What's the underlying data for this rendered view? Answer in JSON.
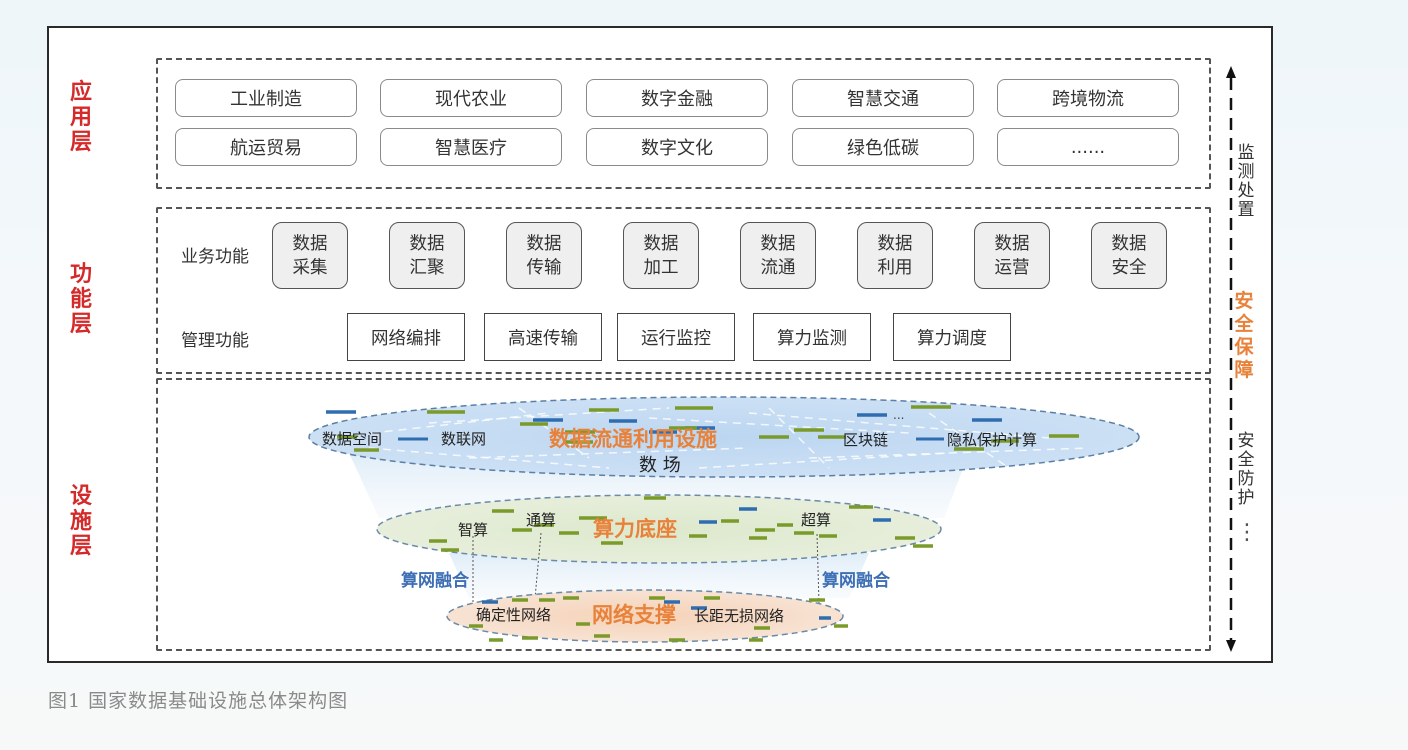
{
  "caption": "图1 国家数据基础设施总体架构图",
  "layers": {
    "application": {
      "label": "应\n用\n层",
      "items": [
        "工业制造",
        "现代农业",
        "数字金融",
        "智慧交通",
        "跨境物流",
        "航运贸易",
        "智慧医疗",
        "数字文化",
        "绿色低碳",
        "......"
      ]
    },
    "function": {
      "label": "功\n能\n层",
      "business_label": "业务功能",
      "business_items": [
        "数据\n采集",
        "数据\n汇聚",
        "数据\n传输",
        "数据\n加工",
        "数据\n流通",
        "数据\n利用",
        "数据\n运营",
        "数据\n安全"
      ],
      "management_label": "管理功能",
      "management_items": [
        "网络编排",
        "高速传输",
        "运行监控",
        "算力监测",
        "算力调度"
      ]
    },
    "facility": {
      "label": "设\n施\n层",
      "data_circulation": {
        "title": "数据流通利用设施",
        "subtitle": "数 场",
        "items": [
          "数据空间",
          "数联网",
          "区块链",
          "隐私保护计算"
        ],
        "ellipsis": "..."
      },
      "computing": {
        "title": "算力底座",
        "items": [
          "智算",
          "通算",
          "超算"
        ]
      },
      "fusion_label_left": "算网融合",
      "fusion_label_right": "算网融合",
      "network": {
        "title": "网络支撑",
        "items": [
          "确定性网络",
          "长距无损网络"
        ]
      }
    }
  },
  "side": {
    "monitor": "监\n测\n处\n置",
    "security": "安\n全\n保\n障",
    "protection": "安\n全\n防\n护",
    "ellipsis": "⋮"
  },
  "colors": {
    "layer_label": "#d42a2a",
    "orange_title": "#e8823a",
    "fusion_blue": "#3e6fb5",
    "seg_green": "#7a9a2a",
    "seg_blue": "#2f6db0",
    "ellipse_blue": "#c5dcf3",
    "ellipse_green": "#e3ecd6",
    "ellipse_peach": "#f7dfcc"
  }
}
